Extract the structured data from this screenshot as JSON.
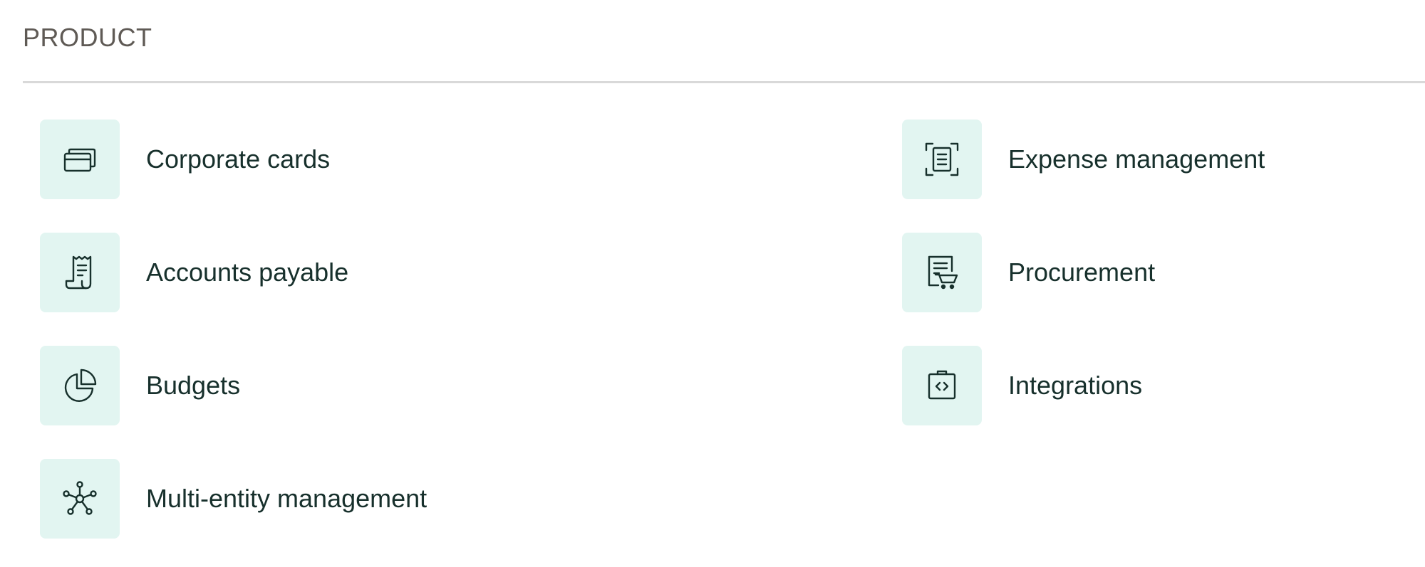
{
  "section": {
    "title": "PRODUCT"
  },
  "items": [
    {
      "label": "Corporate cards",
      "icon": "credit-cards-icon"
    },
    {
      "label": "Expense management",
      "icon": "receipt-scan-icon"
    },
    {
      "label": "Accounts payable",
      "icon": "receipt-scroll-icon"
    },
    {
      "label": "Procurement",
      "icon": "document-cart-icon"
    },
    {
      "label": "Budgets",
      "icon": "pie-chart-icon"
    },
    {
      "label": "Integrations",
      "icon": "code-brackets-icon"
    },
    {
      "label": "Multi-entity management",
      "icon": "network-nodes-icon"
    }
  ],
  "colors": {
    "icon_background": "#e2f5f1",
    "text": "#17302c",
    "section_title": "#5f5a55",
    "divider": "#d9d9d9"
  }
}
